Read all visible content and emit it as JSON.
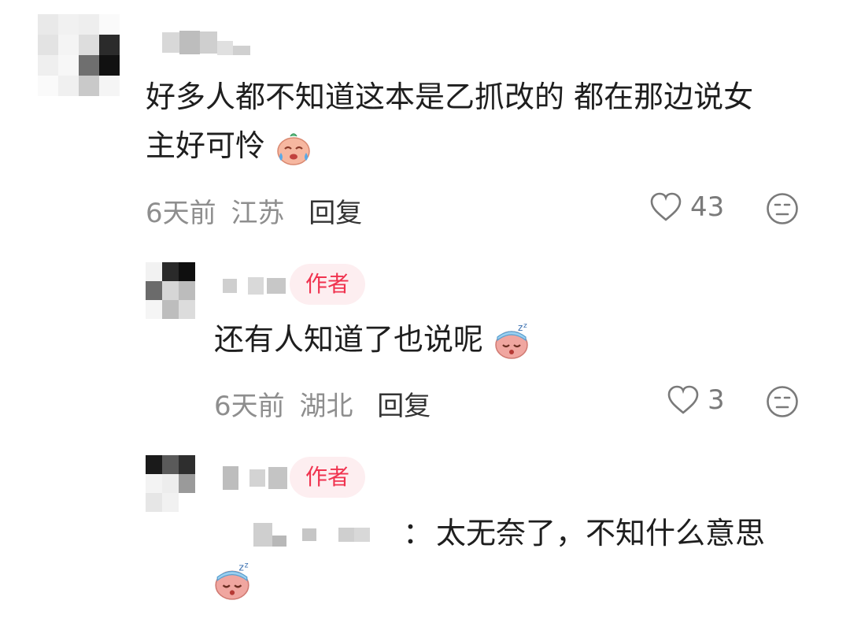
{
  "comments": [
    {
      "text_line1": "好多人都不知道这本是乙抓改的 都在那边说女",
      "text_line2": "主好可怜",
      "emoji": "crying-face-icon",
      "time": "6天前",
      "location": "江苏",
      "reply_label": "回复",
      "likes": "43"
    },
    {
      "badge": "作者",
      "text": "还有人知道了也说呢",
      "emoji": "sleeping-face-icon",
      "time": "6天前",
      "location": "湖北",
      "reply_label": "回复",
      "likes": "3"
    },
    {
      "badge": "作者",
      "quote_sep": "：",
      "text": "太无奈了，不知什么意思",
      "emoji": "sleeping-face-icon"
    }
  ],
  "colors": {
    "badge_bg": "#fdeef0",
    "badge_text": "#f0334f",
    "meta": "#8e8e8e"
  }
}
